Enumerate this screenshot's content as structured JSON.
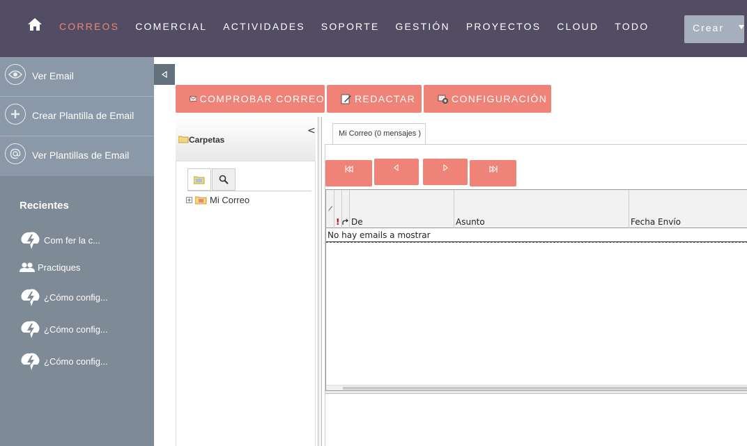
{
  "nav": {
    "items": [
      "CORREOS",
      "COMERCIAL",
      "ACTIVIDADES",
      "SOPORTE",
      "GESTIÓN",
      "PROYECTOS",
      "CLOUD",
      "TODO"
    ],
    "active": "CORREOS",
    "create_label": "Crear"
  },
  "sidebar": {
    "actions": [
      {
        "label": "Ver Email",
        "icon": "eye-icon"
      },
      {
        "label": "Crear Plantilla de Email",
        "icon": "plus-icon"
      },
      {
        "label": "Ver Plantillas de Email",
        "icon": "at-icon"
      }
    ],
    "recent_title": "Recientes",
    "recent": [
      {
        "label": "Com fer la c...",
        "icon": "lightning-icon"
      },
      {
        "label": "Practiques",
        "icon": "users-icon"
      },
      {
        "label": "¿Cómo config...",
        "icon": "lightning-icon"
      },
      {
        "label": "¿Cómo config...",
        "icon": "lightning-icon"
      },
      {
        "label": "¿Cómo config...",
        "icon": "lightning-icon"
      }
    ]
  },
  "toolbar": {
    "check_label": "COMPROBAR CORREO",
    "compose_label": "REDACTAR",
    "settings_label": "CONFIGURACIÓN"
  },
  "folders": {
    "title": "Carpetas",
    "tree_root": "Mi Correo"
  },
  "mail": {
    "tab_label": "Mi Correo (0 mensajes )",
    "columns": [
      "De",
      "Asunto",
      "Fecha Envío"
    ],
    "empty_text": "No hay emails a mostrar"
  },
  "colors": {
    "topbar": "#534d64",
    "accent": "#f08377",
    "sidebar": "#7f8a97"
  }
}
